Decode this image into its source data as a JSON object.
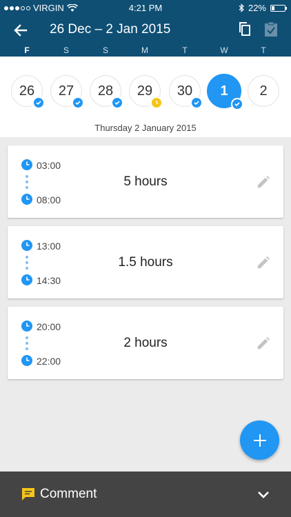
{
  "status_bar": {
    "carrier": "VIRGIN",
    "time": "4:21 PM",
    "battery": "22%",
    "battery_level": 0.22
  },
  "header": {
    "title": "26 Dec – 2 Jan 2015",
    "weekdays": [
      "F",
      "S",
      "S",
      "M",
      "T",
      "W",
      "T"
    ]
  },
  "date_strip": {
    "days": [
      {
        "label": "26",
        "status": "approved"
      },
      {
        "label": "27",
        "status": "approved"
      },
      {
        "label": "28",
        "status": "approved"
      },
      {
        "label": "29",
        "status": "pending"
      },
      {
        "label": "30",
        "status": "approved"
      },
      {
        "label": "1",
        "status": "approved",
        "selected": true
      },
      {
        "label": "2",
        "status": "none"
      }
    ],
    "selected_date_text": "Thursday 2 January 2015"
  },
  "entries": [
    {
      "start": "03:00",
      "end": "08:00",
      "duration": "5 hours"
    },
    {
      "start": "13:00",
      "end": "14:30",
      "duration": "1.5 hours"
    },
    {
      "start": "20:00",
      "end": "22:00",
      "duration": "2 hours"
    }
  ],
  "comment_bar": {
    "label": "Comment"
  },
  "colors": {
    "header": "#0f4f74",
    "accent": "#2196f3",
    "pending": "#f5c518",
    "comment_bar": "#444444",
    "comment_icon": "#f5c518"
  }
}
